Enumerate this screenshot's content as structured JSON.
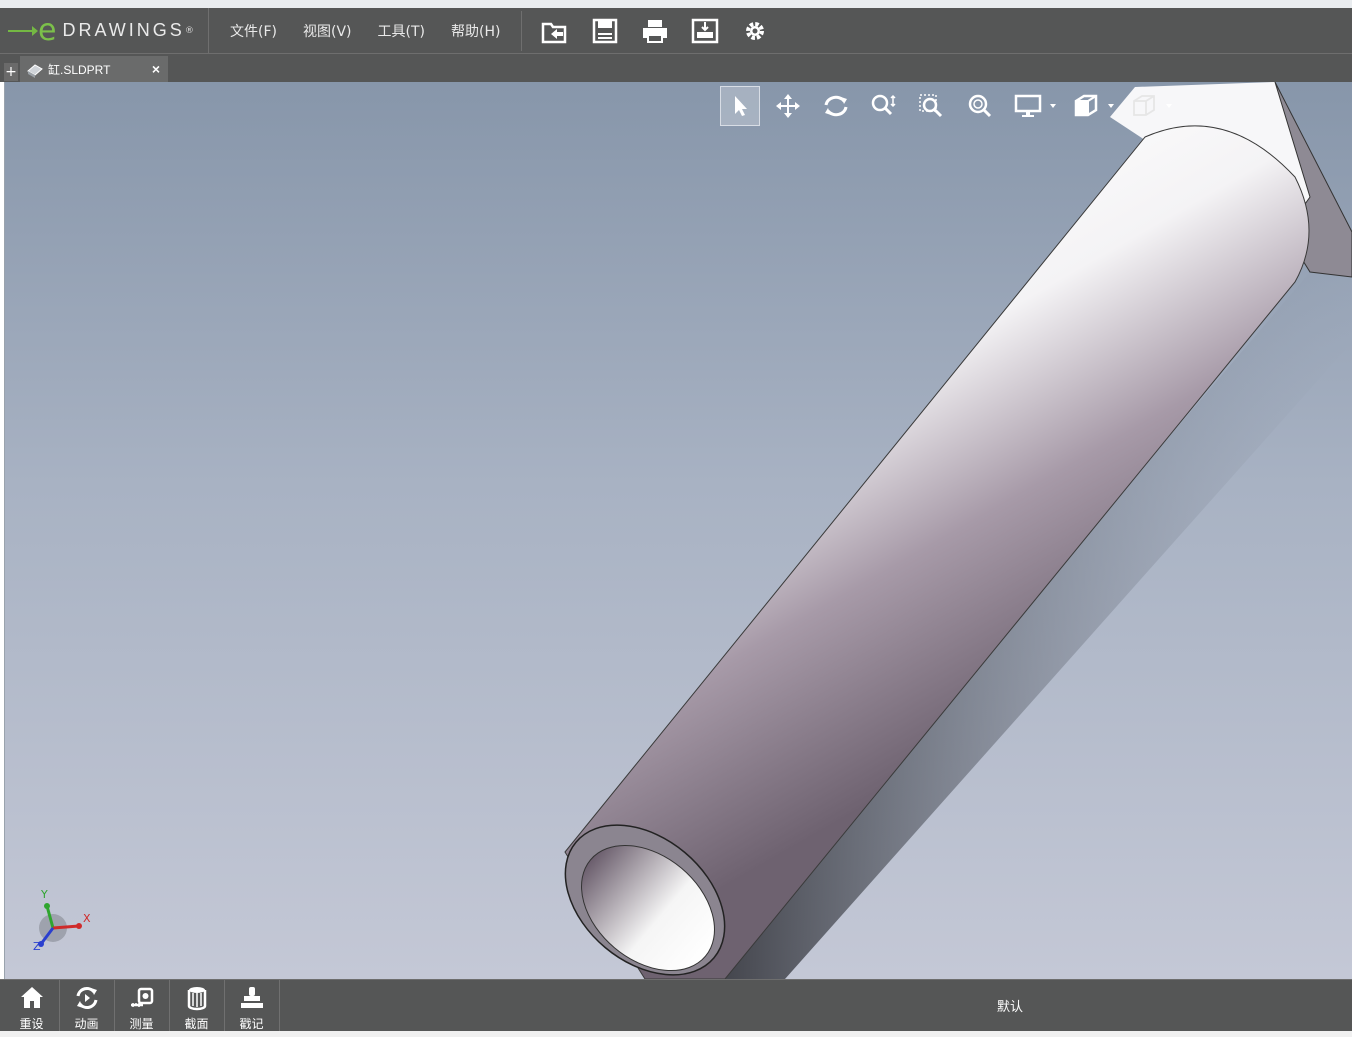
{
  "app": {
    "logo_e": "e",
    "logo_text": "DRAWINGS",
    "logo_mark": "®"
  },
  "menu": [
    {
      "label": "文件(F)"
    },
    {
      "label": "视图(V)"
    },
    {
      "label": "工具(T)"
    },
    {
      "label": "帮助(H)"
    }
  ],
  "toolbar": {
    "icons": [
      "open-folder-icon",
      "save-icon",
      "print-icon",
      "publish-icon",
      "gear-icon"
    ]
  },
  "tabs": [
    {
      "label": "缸.SLDPRT",
      "close": "×"
    }
  ],
  "tab_add": "+",
  "view_tools": {
    "icons": [
      "select-arrow-icon",
      "pan-icon",
      "rotate-icon",
      "zoom-icon",
      "zoom-window-icon",
      "zoom-fit-icon",
      "display-monitor-icon",
      "view-orientation-icon",
      "display-style-icon"
    ]
  },
  "triad": {
    "x": "X",
    "y": "Y",
    "z": "Z"
  },
  "bottom_tools": [
    {
      "label": "重设",
      "icon": "home-icon"
    },
    {
      "label": "动画",
      "icon": "animation-icon"
    },
    {
      "label": "测量",
      "icon": "measure-icon"
    },
    {
      "label": "截面",
      "icon": "section-icon"
    },
    {
      "label": "戳记",
      "icon": "stamp-icon"
    }
  ],
  "status": {
    "configuration": "默认"
  },
  "colors": {
    "chrome": "#555656",
    "accent_green": "#7cc04a",
    "viewport_top": "#8796aa",
    "viewport_bottom": "#c4c8d6"
  }
}
